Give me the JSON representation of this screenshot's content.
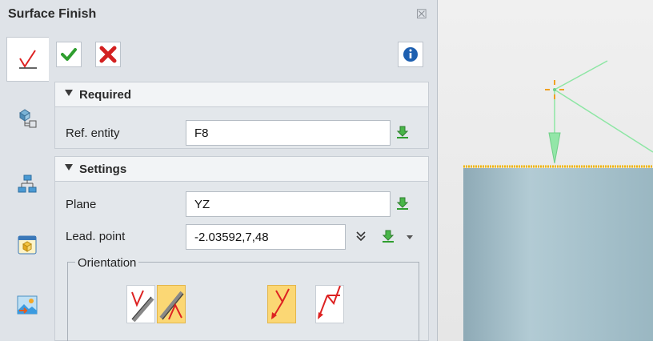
{
  "dialog": {
    "title": "Surface Finish",
    "close_glyph": "☒"
  },
  "tabs": [
    {
      "name": "tab-surface-finish",
      "icon": "checkmark-symbol-icon",
      "active": true
    },
    {
      "name": "tab-feature-tree",
      "icon": "part-tree-icon",
      "active": false
    },
    {
      "name": "tab-assembly-tree",
      "icon": "hierarchy-icon",
      "active": false
    },
    {
      "name": "tab-view-manager",
      "icon": "cube-view-icon",
      "active": false
    },
    {
      "name": "tab-image-manager",
      "icon": "image-export-icon",
      "active": false
    }
  ],
  "toolbar": {
    "ok_icon": "green-check-icon",
    "cancel_icon": "red-x-icon",
    "info_icon": "info-icon"
  },
  "required": {
    "header": "Required",
    "ref_entity_label": "Ref. entity",
    "ref_entity_value": "F8"
  },
  "settings": {
    "header": "Settings",
    "plane_label": "Plane",
    "plane_value": "YZ",
    "lead_point_label": "Lead. point",
    "lead_point_value": "-2.03592,7,48",
    "orientation_label": "Orientation",
    "orientation_buttons": [
      {
        "name": "orientation-left-option",
        "selected": false
      },
      {
        "name": "orientation-left-flipped-option",
        "selected": true
      },
      {
        "name": "orientation-leader-down-option",
        "selected": true
      },
      {
        "name": "orientation-leader-up-option",
        "selected": false
      }
    ]
  },
  "colors": {
    "accent_selected": "#fbd774",
    "model_body": "#a6c0ca",
    "leader_green": "#7fe39a",
    "edge_highlight": "#f0b400"
  }
}
